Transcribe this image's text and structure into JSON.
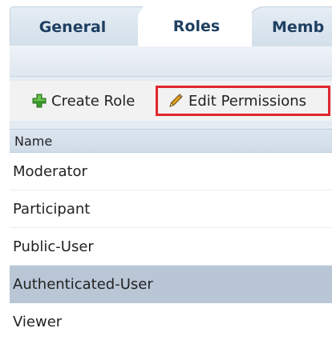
{
  "tabs": [
    {
      "label": "General",
      "selected": false
    },
    {
      "label": "Roles",
      "selected": true
    },
    {
      "label": "Memb",
      "selected": false
    }
  ],
  "toolbar": {
    "create_label": "Create Role",
    "create_icon": "green-plus-icon",
    "edit_label": "Edit Permissions",
    "edit_icon": "pencil-icon",
    "highlight_color": "#e0262d"
  },
  "table": {
    "column_header": "Name",
    "rows": [
      {
        "name": "Moderator",
        "selected": false
      },
      {
        "name": "Participant",
        "selected": false
      },
      {
        "name": "Public-User",
        "selected": false
      },
      {
        "name": "Authenticated-User",
        "selected": true
      },
      {
        "name": "Viewer",
        "selected": false
      }
    ]
  },
  "colors": {
    "tab_text": "#1f3f62",
    "panel_bg": "#e4ebf2",
    "selected_row": "#b9c6d6"
  }
}
